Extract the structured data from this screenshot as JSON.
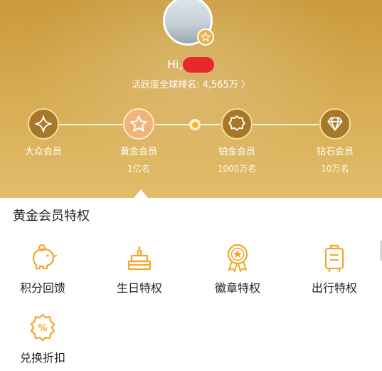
{
  "header": {
    "greeting": "Hi,",
    "rank_text": "活跃度全球排名: 4,565万 〉",
    "current_level_index": 1
  },
  "levels": [
    {
      "name": "大众会员",
      "count": "",
      "icon": "diamond-star-icon"
    },
    {
      "name": "黄金会员",
      "count": "1亿名",
      "icon": "star-icon"
    },
    {
      "name": "铂金会员",
      "count": "1000万名",
      "icon": "badge-icon"
    },
    {
      "name": "钻石会员",
      "count": "10万名",
      "icon": "diamond-icon"
    }
  ],
  "privileges": {
    "title": "黄金会员特权",
    "items": [
      {
        "label": "积分回馈",
        "icon": "piggy-bank-icon"
      },
      {
        "label": "生日特权",
        "icon": "birthday-cake-icon"
      },
      {
        "label": "徽章特权",
        "icon": "medal-icon"
      },
      {
        "label": "出行特权",
        "icon": "luggage-icon"
      },
      {
        "label": "兑换折扣",
        "icon": "discount-percent-icon"
      }
    ]
  },
  "colors": {
    "header_gold": "#d8ae56",
    "accent_orange": "#f3a72a",
    "text_dark": "#222222"
  }
}
